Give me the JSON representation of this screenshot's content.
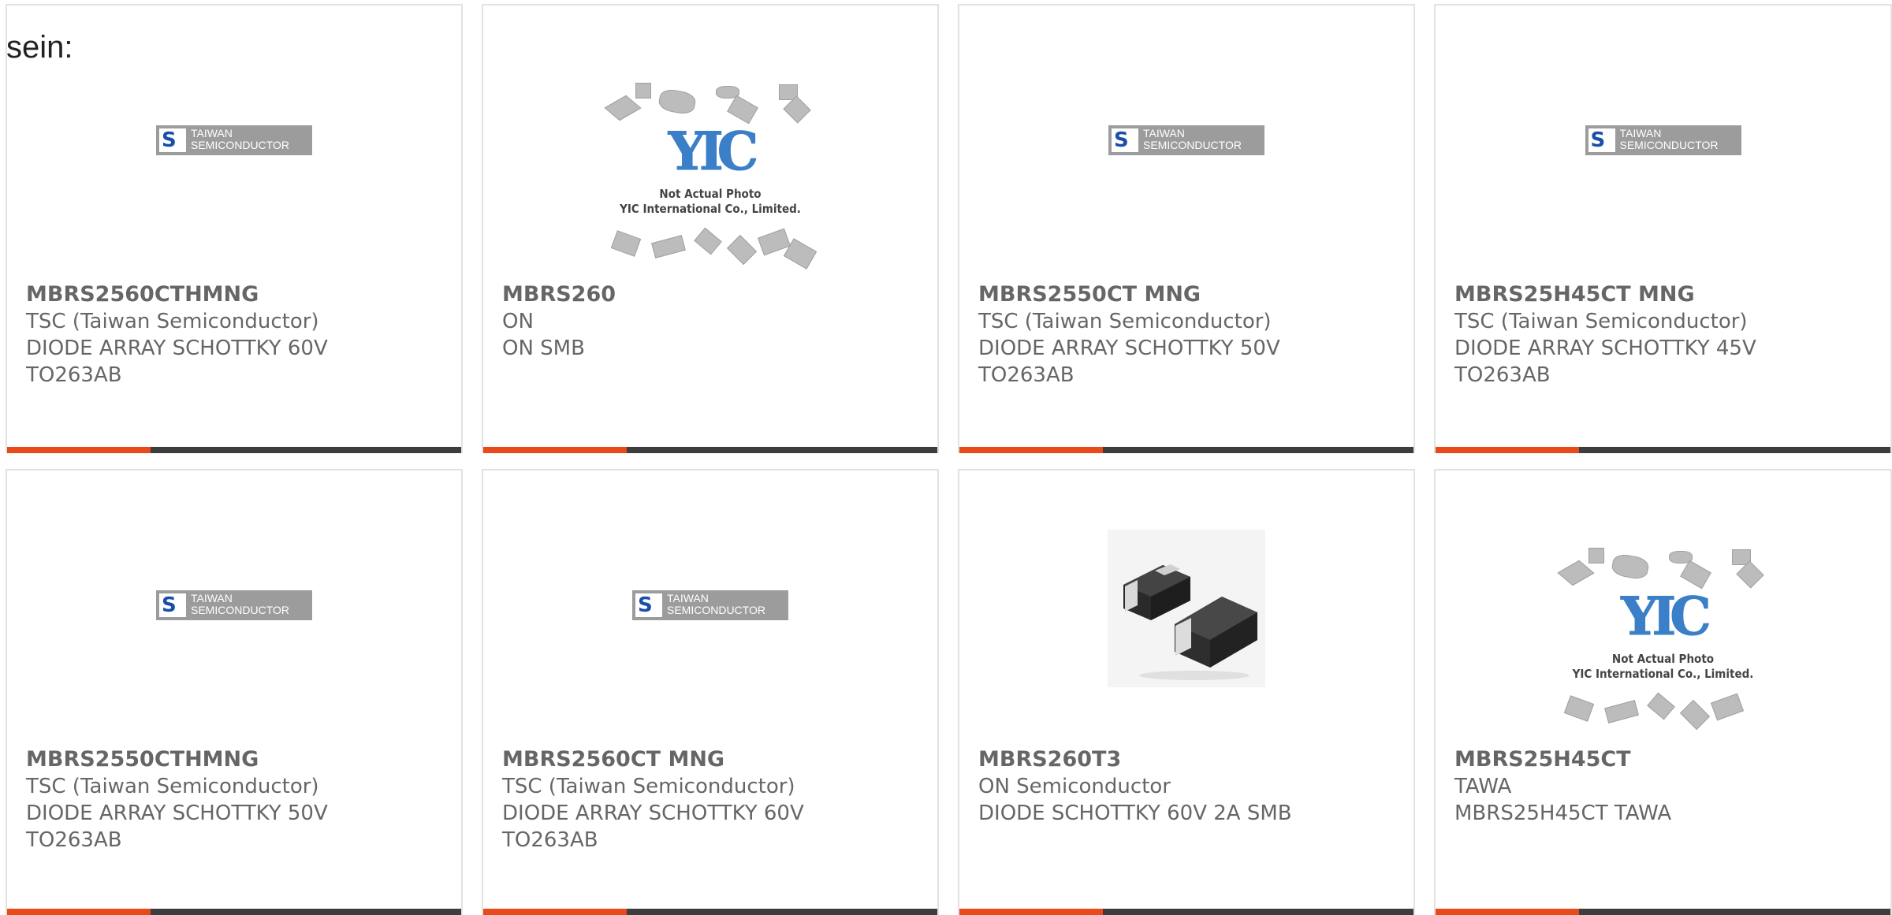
{
  "lead_text": "sein:",
  "colors": {
    "accent_bar": "#e84a1a",
    "bar": "#3d3d3d",
    "border": "#e2e2e2",
    "text": "#666666"
  },
  "products": [
    {
      "part": "MBRS2560CTHMNG",
      "maker": "TSC (Taiwan Semiconductor)",
      "desc1": "DIODE ARRAY SCHOTTKY 60V",
      "desc2": "TO263AB",
      "image": "tsc-logo"
    },
    {
      "part": "MBRS260",
      "maker": "ON",
      "desc1": "ON SMB",
      "desc2": "",
      "image": "yic-placeholder"
    },
    {
      "part": "MBRS2550CT MNG",
      "maker": "TSC (Taiwan Semiconductor)",
      "desc1": "DIODE ARRAY SCHOTTKY 50V",
      "desc2": "TO263AB",
      "image": "tsc-logo"
    },
    {
      "part": "MBRS25H45CT MNG",
      "maker": "TSC (Taiwan Semiconductor)",
      "desc1": "DIODE ARRAY SCHOTTKY 45V",
      "desc2": "TO263AB",
      "image": "tsc-logo"
    },
    {
      "part": "MBRS2550CTHMNG",
      "maker": "TSC (Taiwan Semiconductor)",
      "desc1": "DIODE ARRAY SCHOTTKY 50V",
      "desc2": "TO263AB",
      "image": "tsc-logo"
    },
    {
      "part": "MBRS2560CT MNG",
      "maker": "TSC (Taiwan Semiconductor)",
      "desc1": "DIODE ARRAY SCHOTTKY 60V",
      "desc2": "TO263AB",
      "image": "tsc-logo"
    },
    {
      "part": "MBRS260T3",
      "maker": "ON Semiconductor",
      "desc1": "DIODE SCHOTTKY 60V 2A SMB",
      "desc2": "",
      "image": "smb-package-photo"
    },
    {
      "part": "MBRS25H45CT",
      "maker": "TAWA",
      "desc1": "MBRS25H45CT TAWA",
      "desc2": "",
      "image": "yic-placeholder"
    }
  ],
  "tsc_logo": {
    "line1": "TAIWAN",
    "line2": "SEMICONDUCTOR",
    "mark": "S"
  },
  "yic_placeholder": {
    "logo": "YIC",
    "line1": "Not Actual Photo",
    "line2": "YIC International Co., Limited."
  }
}
